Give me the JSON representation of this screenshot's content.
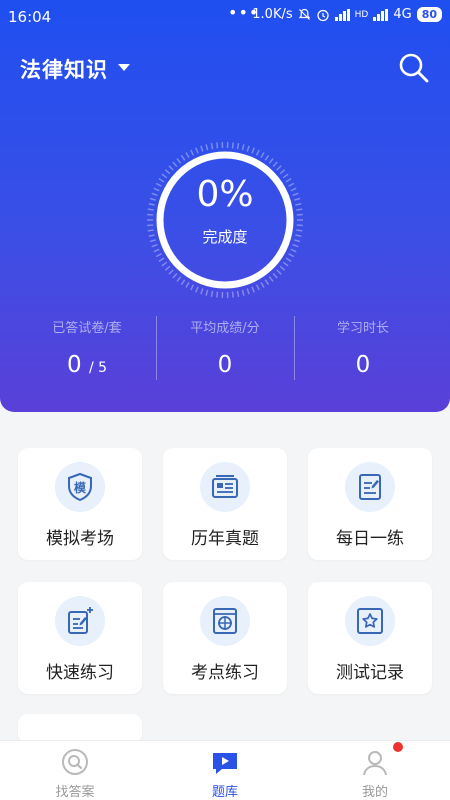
{
  "status_bar": {
    "time": "16:04",
    "dots": "•••",
    "speed": "1.0K/s",
    "net_hd": "HD",
    "net_type": "4G",
    "battery": "80"
  },
  "header": {
    "title": "法律知识"
  },
  "progress": {
    "percent_label": "0%",
    "label": "完成度",
    "value": 0
  },
  "stats": [
    {
      "label": "已答试卷/套",
      "value": "0",
      "total": "/ 5"
    },
    {
      "label": "平均成绩/分",
      "value": "0"
    },
    {
      "label": "学习时长",
      "value": "0"
    }
  ],
  "menu": [
    {
      "label": "模拟考场",
      "icon": "shield-mo-icon"
    },
    {
      "label": "历年真题",
      "icon": "newspaper-icon"
    },
    {
      "label": "每日一练",
      "icon": "notepad-icon"
    },
    {
      "label": "快速练习",
      "icon": "quick-edit-icon"
    },
    {
      "label": "考点练习",
      "icon": "target-icon"
    },
    {
      "label": "测试记录",
      "icon": "star-icon"
    }
  ],
  "tabbar": [
    {
      "label": "找答案",
      "icon": "search-icon"
    },
    {
      "label": "题库",
      "icon": "play-flag-icon"
    },
    {
      "label": "我的",
      "icon": "user-icon"
    }
  ],
  "colors": {
    "primary": "#2a52e6",
    "hero_top": "#1f4ff0",
    "hero_bottom": "#5a40d8",
    "icon_bg": "#e7f0fb",
    "badge": "#f0332f"
  }
}
